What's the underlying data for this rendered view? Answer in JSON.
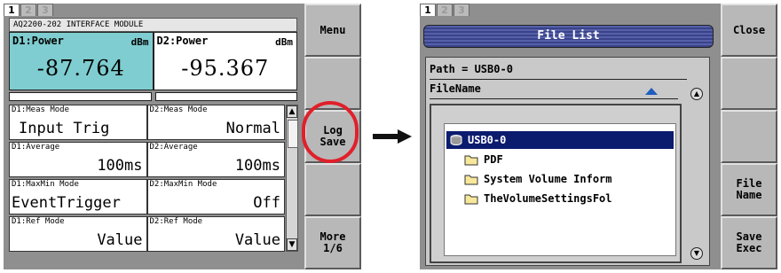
{
  "left_screen": {
    "tabs": [
      "1",
      "2",
      "3"
    ],
    "module_title": "AQ2200-202 INTERFACE MODULE",
    "d1": {
      "label": "D1:Power",
      "unit": "dBm",
      "value": "-87.764"
    },
    "d2": {
      "label": "D2:Power",
      "unit": "dBm",
      "value": "-95.367"
    },
    "settings": [
      {
        "d1_label": "D1:Meas Mode",
        "d1_value": "Input Trig",
        "d2_label": "D2:Meas Mode",
        "d2_value": "Normal"
      },
      {
        "d1_label": "D1:Average",
        "d1_value": "100ms",
        "d2_label": "D2:Average",
        "d2_value": "100ms"
      },
      {
        "d1_label": "D1:MaxMin Mode",
        "d1_value": "EventTrigger",
        "d2_label": "D2:MaxMin Mode",
        "d2_value": "Off"
      },
      {
        "d1_label": "D1:Ref Mode",
        "d1_value": "Value",
        "d2_label": "D2:Ref Mode",
        "d2_value": "Value"
      }
    ],
    "softkeys": [
      "Menu",
      "",
      "Log\nSave",
      "",
      "More\n1/6"
    ]
  },
  "right_screen": {
    "tabs": [
      "1",
      "2",
      "3"
    ],
    "title": "File List",
    "path": "Path = USB0-0",
    "filename_header": "FileName",
    "items": [
      {
        "name": "USB0-0",
        "icon": "usb-drive-icon",
        "selected": true
      },
      {
        "name": "PDF",
        "icon": "folder-icon",
        "selected": false
      },
      {
        "name": "System Volume Inform",
        "icon": "folder-icon",
        "selected": false
      },
      {
        "name": "TheVolumeSettingsFol",
        "icon": "folder-icon",
        "selected": false
      }
    ],
    "softkeys": [
      "Close",
      "",
      "",
      "File\nName",
      "Save\nExec"
    ]
  },
  "colors": {
    "highlight": "#e0202a",
    "d1_background": "#7fcdd0",
    "title_bar": "#3a438a",
    "selection": "#0b1b6e",
    "sort_arrow": "#1f5dbf"
  }
}
